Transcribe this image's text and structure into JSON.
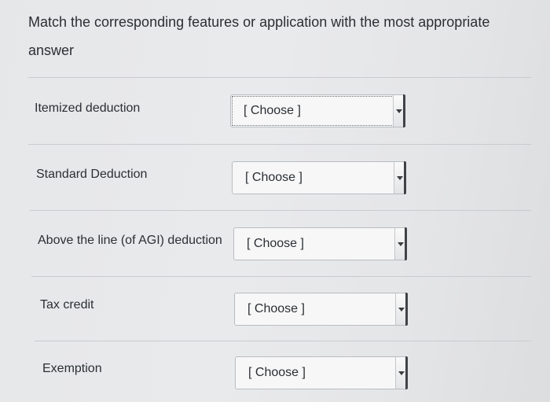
{
  "question": {
    "text": "Match the corresponding features or application with the most appropriate answer"
  },
  "matches": [
    {
      "label": "Itemized deduction",
      "selected": "[ Choose ]"
    },
    {
      "label": "Standard Deduction",
      "selected": "[ Choose ]"
    },
    {
      "label": "Above the line (of AGI) deduction",
      "selected": "[ Choose ]"
    },
    {
      "label": "Tax credit",
      "selected": "[ Choose ]"
    },
    {
      "label": "Exemption",
      "selected": "[ Choose ]"
    }
  ],
  "icons": {
    "dropdown": "chevron-down-icon"
  }
}
